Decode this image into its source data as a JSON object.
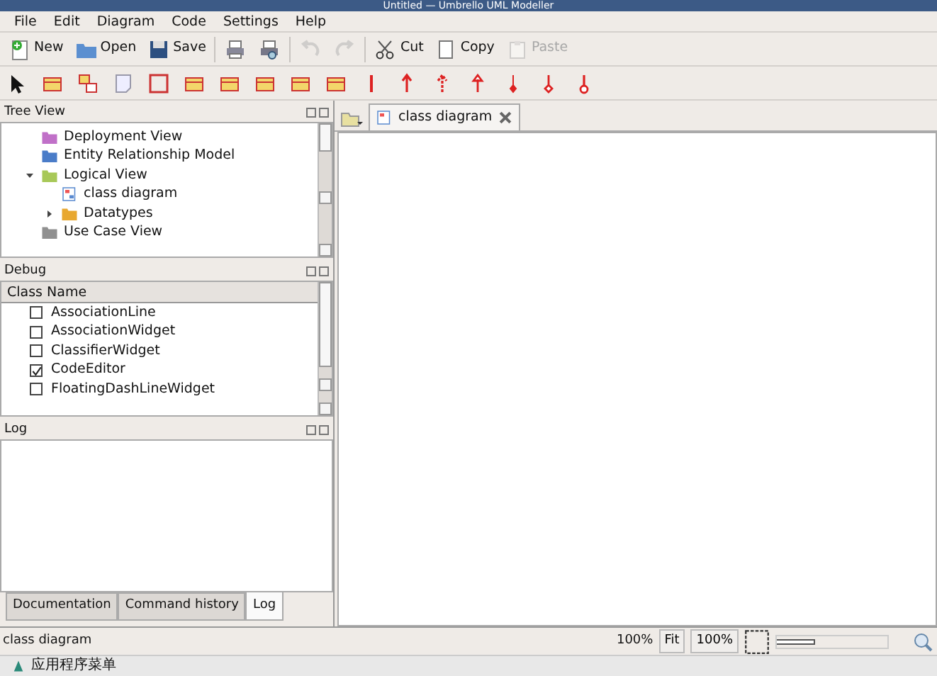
{
  "window": {
    "title": "Untitled — Umbrello UML Modeller"
  },
  "menu": [
    "File",
    "Edit",
    "Diagram",
    "Code",
    "Settings",
    "Help"
  ],
  "toolbar": [
    {
      "kind": "new",
      "label": "New",
      "disabled": false
    },
    {
      "kind": "open",
      "label": "Open",
      "disabled": false
    },
    {
      "kind": "save",
      "label": "Save",
      "disabled": false
    },
    {
      "kind": "print",
      "disabled": false
    },
    {
      "kind": "preview",
      "disabled": false
    },
    {
      "kind": "undo",
      "disabled": true
    },
    {
      "kind": "redo",
      "disabled": true
    },
    {
      "kind": "cut",
      "label": "Cut",
      "disabled": false
    },
    {
      "kind": "copy",
      "label": "Copy",
      "disabled": false
    },
    {
      "kind": "paste",
      "label": "Paste",
      "disabled": true
    }
  ],
  "tree_view": {
    "title": "Tree View",
    "items": [
      {
        "label": "Deployment View",
        "kind": "folder",
        "color": "#c070c8"
      },
      {
        "label": "Entity Relationship Model",
        "kind": "folder",
        "color": "#4a7cc8"
      },
      {
        "label": "Logical View",
        "kind": "folder",
        "color": "#a8c858",
        "expanded": true,
        "children": [
          {
            "label": "class diagram",
            "kind": "diagram",
            "color": "#5a8ad0"
          },
          {
            "label": "Datatypes",
            "kind": "folder",
            "color": "#e8a830",
            "expanded": false
          }
        ]
      },
      {
        "label": "Use Case View",
        "kind": "folder",
        "color": "#909090"
      }
    ]
  },
  "debug": {
    "title": "Debug",
    "column": "Class Name",
    "rows": [
      {
        "label": "AssociationLine",
        "checked": false
      },
      {
        "label": "AssociationWidget",
        "checked": false
      },
      {
        "label": "ClassifierWidget",
        "checked": false
      },
      {
        "label": "CodeEditor",
        "checked": true
      },
      {
        "label": "FloatingDashLineWidget",
        "checked": false
      }
    ]
  },
  "log": {
    "title": "Log"
  },
  "bottom_tabs": [
    {
      "label": "Documentation",
      "selected": false
    },
    {
      "label": "Command history",
      "selected": false
    },
    {
      "label": "Log",
      "selected": true
    }
  ],
  "diagram_tabs": [
    {
      "label": "class diagram",
      "selected": true
    }
  ],
  "status_bar": {
    "text": "class diagram",
    "zoom": "100%",
    "fit": "Fit",
    "reset": "100%",
    "zoom_slider": {
      "level": 0.35
    }
  },
  "taskbar": {
    "menu": "应用程序菜单"
  }
}
